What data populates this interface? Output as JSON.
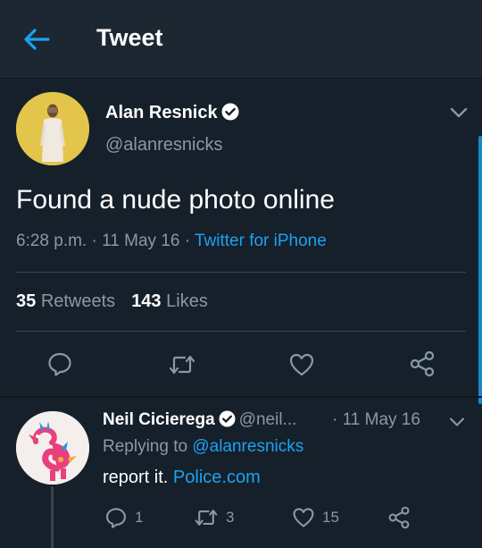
{
  "header": {
    "title": "Tweet",
    "back_icon": "arrow-left-icon"
  },
  "colors": {
    "background": "#15202b",
    "accent": "#1da1f2",
    "secondary_text": "#8899a6"
  },
  "tweet": {
    "author_name": "Alan Resnick",
    "author_handle": "@alanresnicks",
    "verified": true,
    "text": "Found a nude photo online",
    "time": "6:28 p.m.",
    "date": "11 May 16",
    "source": "Twitter for iPhone",
    "retweets_count": "35",
    "retweets_label": "Retweets",
    "likes_count": "143",
    "likes_label": "Likes"
  },
  "reply": {
    "author_name": "Neil Cicierega",
    "author_handle": "@neil...",
    "date": "11 May 16",
    "verified": true,
    "replying_label": "Replying to",
    "replying_to": "@alanresnicks",
    "text": "report it.",
    "link": "Police.com",
    "reply_count": "1",
    "retweet_count": "3",
    "like_count": "15"
  }
}
